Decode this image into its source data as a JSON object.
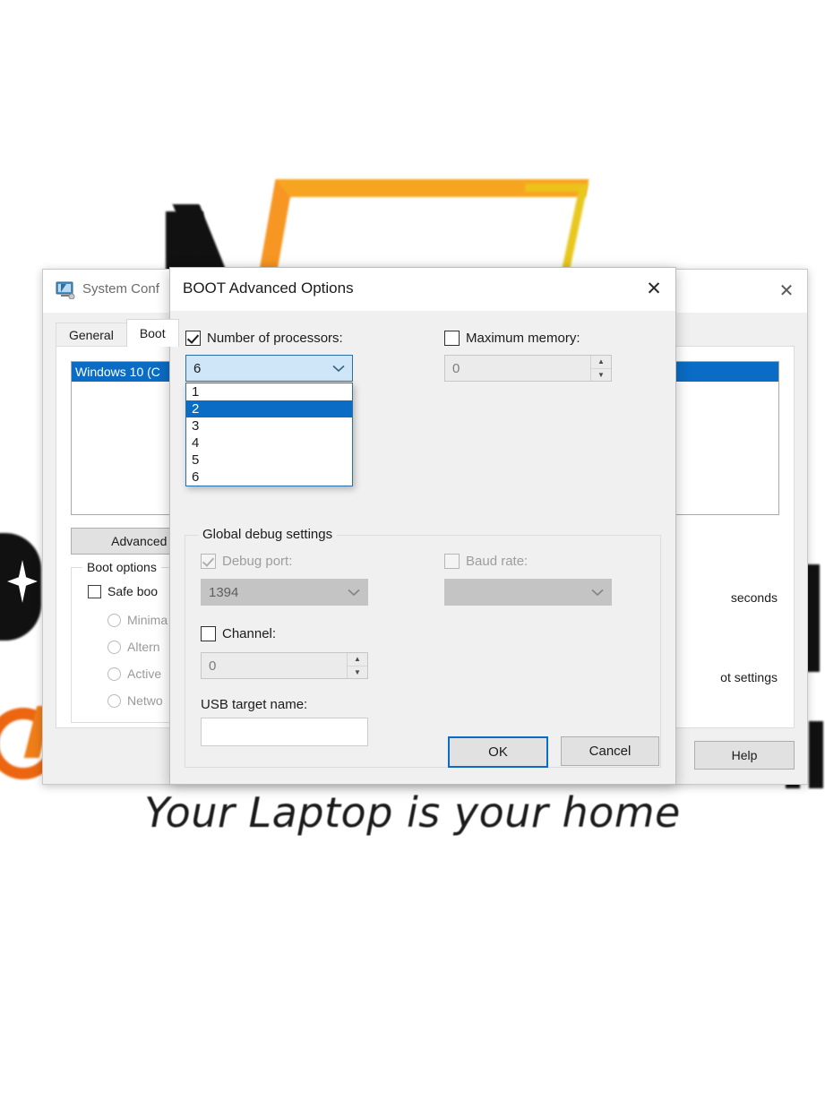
{
  "background_poster": {
    "tagline": "Your Laptop is your home",
    "accent_orange": "#f7941e",
    "accent_yellow": "#e8c81e",
    "accent_red_orange": "#ec6611"
  },
  "back_window": {
    "title": "System Conf",
    "icon": "system-configuration-icon",
    "close_label": "✕",
    "tabs": [
      {
        "label": "General",
        "active": false
      },
      {
        "label": "Boot",
        "active": true
      }
    ],
    "os_list": {
      "selected_entry": "Windows 10 (C"
    },
    "advanced_button": "Advanced op",
    "boot_options": {
      "legend": "Boot options",
      "safe_boot": "Safe boo",
      "radios": [
        "Minima",
        "Altern",
        "Active",
        "Netwo"
      ]
    },
    "right_texts": {
      "timeout_units": "seconds",
      "permanent_settings": "ot settings"
    },
    "buttons": [
      "Help"
    ]
  },
  "modal": {
    "title": "BOOT Advanced Options",
    "close_label": "✕",
    "number_of_processors": {
      "label": "Number of processors:",
      "checked": true,
      "value": "6",
      "caret": "⌄",
      "options": [
        "1",
        "2",
        "3",
        "4",
        "5",
        "6"
      ],
      "highlighted_option": "2"
    },
    "maximum_memory": {
      "label": "Maximum memory:",
      "checked": false,
      "value": "0",
      "up": "▲",
      "down": "▼"
    },
    "global_debug_settings": {
      "legend": "Global debug settings",
      "debug_port": {
        "label": "Debug port:",
        "checked": true,
        "enabled": false,
        "value": "1394",
        "caret": "⌄"
      },
      "baud_rate": {
        "label": "Baud rate:",
        "checked": false,
        "enabled": false,
        "value": "",
        "caret": "⌄"
      },
      "channel": {
        "label": "Channel:",
        "checked": false,
        "value": "0",
        "up": "▲",
        "down": "▼"
      },
      "usb_target_name": {
        "label": "USB target name:",
        "value": ""
      }
    },
    "buttons": {
      "ok": "OK",
      "cancel": "Cancel"
    },
    "accent": "#0a6cc4"
  }
}
